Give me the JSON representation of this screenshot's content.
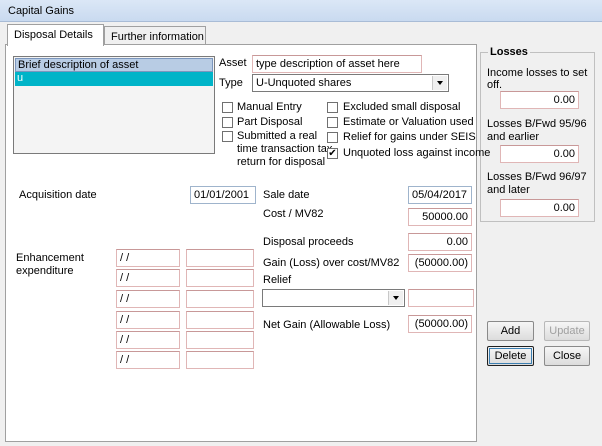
{
  "window": {
    "title": "Capital Gains"
  },
  "tabs": [
    {
      "label": "Disposal Details",
      "active": true
    },
    {
      "label": "Further information",
      "active": false
    }
  ],
  "asset_list": {
    "header": "Brief description of asset",
    "selected_item": "u",
    "selected_color": "#00b4c8"
  },
  "asset": {
    "asset_label": "Asset",
    "asset_value": "type description of asset here",
    "type_label": "Type",
    "type_value": "U-Unquoted shares"
  },
  "checkboxes": [
    {
      "label": "Manual Entry",
      "checked": false
    },
    {
      "label": "Part Disposal",
      "checked": false
    },
    {
      "label": "Submitted a real time transaction tax return for disposal",
      "checked": false
    },
    {
      "label": "Excluded small disposal",
      "checked": false
    },
    {
      "label": "Estimate or Valuation used",
      "checked": false
    },
    {
      "label": "Relief for gains under SEIS",
      "checked": false
    },
    {
      "label": "Unquoted loss against income",
      "checked": true
    }
  ],
  "check_mark": "✔",
  "submitted_lines": [
    "Submitted a real",
    "time transaction tax",
    "return for disposal"
  ],
  "acquisition": {
    "label": "Acquisition date",
    "value": "01/01/2001"
  },
  "sale": {
    "date_label": "Sale date",
    "date_value": "05/04/2017",
    "cost_label": "Cost / MV82",
    "cost_value": "50000.00",
    "proceeds_label": "Disposal proceeds",
    "proceeds_value": "0.00",
    "gain_label": "Gain (Loss) over cost/MV82",
    "gain_value": "(50000.00)",
    "relief_label": "Relief",
    "relief_value": "",
    "net_label": "Net Gain (Allowable Loss)",
    "net_value": "(50000.00)"
  },
  "enhancement": {
    "label_line1": "Enhancement",
    "label_line2": "expenditure",
    "rows": [
      {
        "date": " / /",
        "amount": ""
      },
      {
        "date": " / /",
        "amount": ""
      },
      {
        "date": " / /",
        "amount": ""
      },
      {
        "date": " / /",
        "amount": ""
      },
      {
        "date": " / /",
        "amount": ""
      },
      {
        "date": " / /",
        "amount": ""
      }
    ]
  },
  "losses": {
    "title": "Losses",
    "income_label_1": "Income losses to set",
    "income_label_2": "off.",
    "income_value": "0.00",
    "bfwd_9596_label_1": "Losses B/Fwd 95/96",
    "bfwd_9596_label_2": "and earlier",
    "bfwd_9596_value": "0.00",
    "bfwd_9697_label_1": "Losses B/Fwd 96/97",
    "bfwd_9697_label_2": "and later",
    "bfwd_9697_value": "0.00"
  },
  "buttons": {
    "add": "Add",
    "update": "Update",
    "delete": "Delete",
    "close": "Close"
  }
}
